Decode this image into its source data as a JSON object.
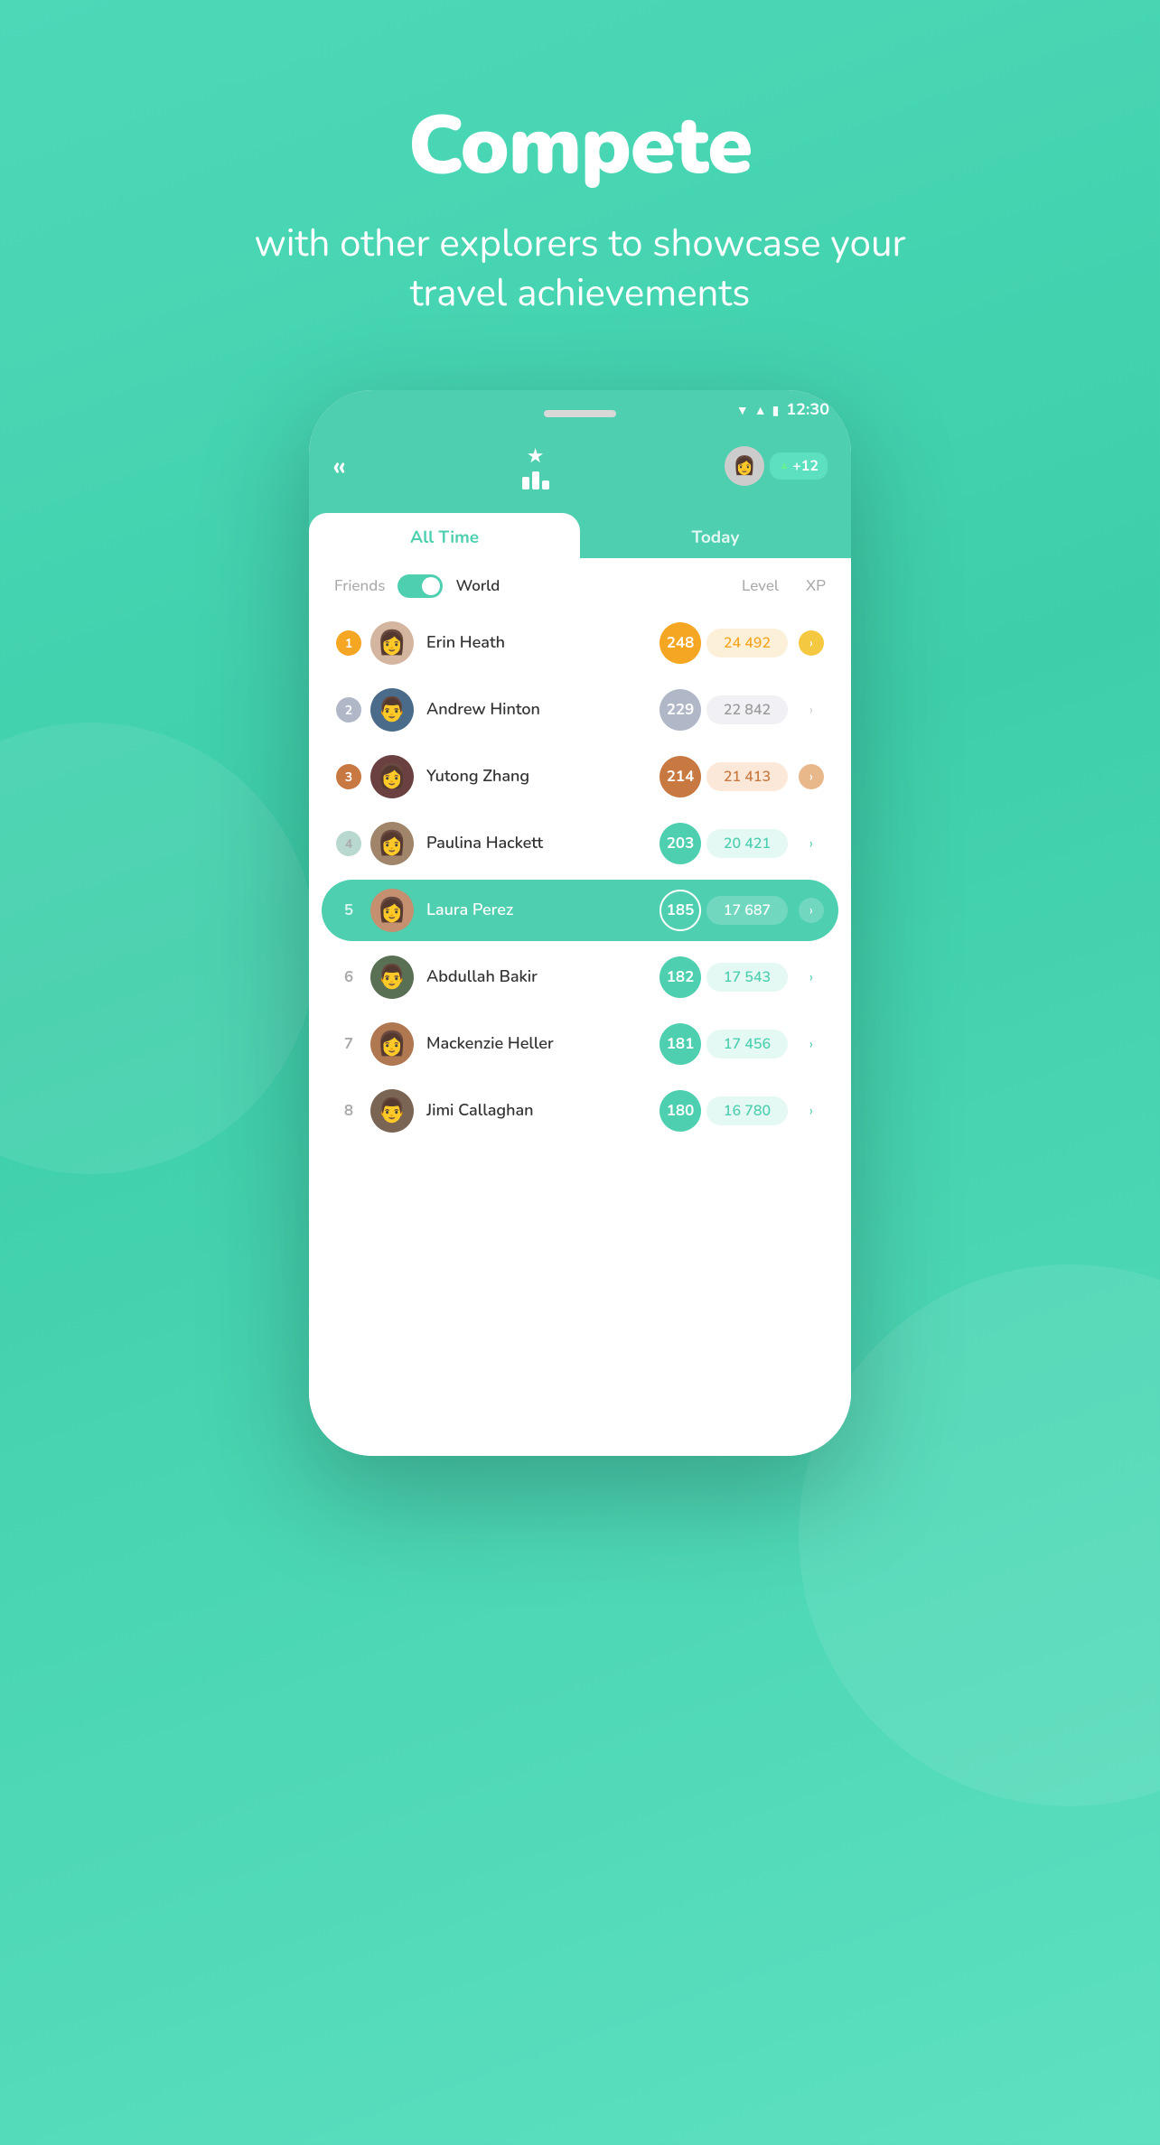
{
  "hero": {
    "title": "Compete",
    "subtitle": "with other explorers to showcase your travel achievements"
  },
  "status_bar": {
    "time": "12:30"
  },
  "header": {
    "back_label": "«",
    "rank_delta": "+12"
  },
  "tabs": [
    {
      "id": "all_time",
      "label": "All Time",
      "active": true
    },
    {
      "id": "today",
      "label": "Today",
      "active": false
    }
  ],
  "filter": {
    "friends_label": "Friends",
    "world_label": "World",
    "level_label": "Level",
    "xp_label": "XP"
  },
  "leaderboard": [
    {
      "rank": "1",
      "name": "Erin Heath",
      "level": "248",
      "xp": "24 492",
      "class": "lb-1"
    },
    {
      "rank": "2",
      "name": "Andrew Hinton",
      "level": "229",
      "xp": "22 842",
      "class": "lb-2"
    },
    {
      "rank": "3",
      "name": "Yutong Zhang",
      "level": "214",
      "xp": "21 413",
      "class": "lb-3"
    },
    {
      "rank": "4",
      "name": "Paulina Hackett",
      "level": "203",
      "xp": "20 421",
      "class": "lb-4"
    },
    {
      "rank": "5",
      "name": "Laura Perez",
      "level": "185",
      "xp": "17 687",
      "class": "lb-highlight"
    },
    {
      "rank": "6",
      "name": "Abdullah Bakir",
      "level": "182",
      "xp": "17 543",
      "class": "lb-6"
    },
    {
      "rank": "7",
      "name": "Mackenzie Heller",
      "level": "181",
      "xp": "17 456",
      "class": "lb-7"
    },
    {
      "rank": "8",
      "name": "Jimi Callaghan",
      "level": "180",
      "xp": "16 780",
      "class": "lb-8"
    }
  ],
  "rank_colors": [
    "rank-1",
    "rank-2",
    "rank-3",
    "rank-4",
    "rank-plain",
    "rank-plain",
    "rank-plain",
    "rank-plain"
  ],
  "avatar_classes": [
    "av-1",
    "av-2",
    "av-3",
    "av-4",
    "av-5",
    "av-6",
    "av-7",
    "av-8"
  ],
  "avatar_emojis": [
    "👩",
    "👨",
    "👩",
    "👩",
    "👩",
    "👨",
    "👩",
    "👨"
  ]
}
